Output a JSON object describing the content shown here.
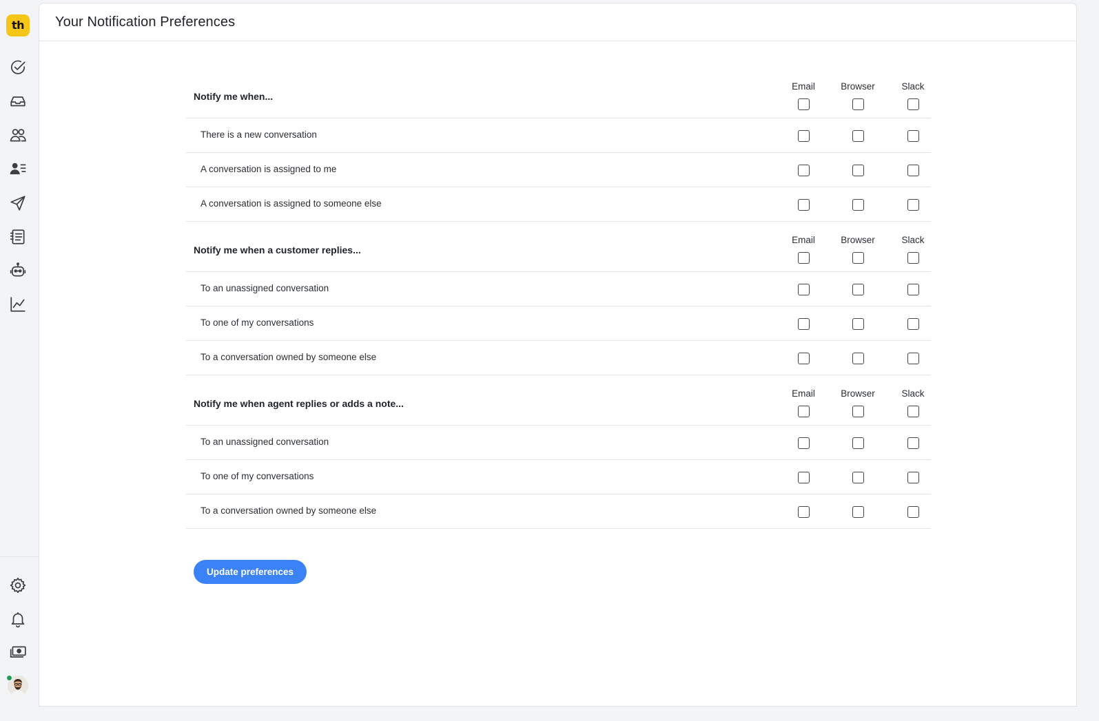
{
  "app": {
    "logo_text": "th",
    "brand_color": "#f5c518",
    "accent_color": "#3b82f6"
  },
  "sidebar": {
    "top_items": [
      {
        "name": "tasks-icon"
      },
      {
        "name": "inbox-icon"
      },
      {
        "name": "team-icon"
      },
      {
        "name": "contacts-icon"
      },
      {
        "name": "send-icon"
      },
      {
        "name": "list-icon"
      },
      {
        "name": "bot-icon"
      },
      {
        "name": "reports-icon"
      }
    ],
    "bottom_items": [
      {
        "name": "settings-icon"
      },
      {
        "name": "bell-icon"
      },
      {
        "name": "billing-icon"
      }
    ],
    "status_color": "#1f9d55"
  },
  "header": {
    "title": "Your Notification Preferences"
  },
  "columns": {
    "email": "Email",
    "browser": "Browser",
    "slack": "Slack"
  },
  "sections": [
    {
      "title": "Notify me when...",
      "rows": [
        "There is a new conversation",
        "A conversation is assigned to me",
        "A conversation is assigned to someone else"
      ]
    },
    {
      "title": "Notify me when a customer replies...",
      "rows": [
        "To an unassigned conversation",
        "To one of my conversations",
        "To a conversation owned by someone else"
      ]
    },
    {
      "title": "Notify me when agent replies or adds a note...",
      "rows": [
        "To an unassigned conversation",
        "To one of my conversations",
        "To a conversation owned by someone else"
      ]
    }
  ],
  "actions": {
    "update_label": "Update preferences"
  }
}
